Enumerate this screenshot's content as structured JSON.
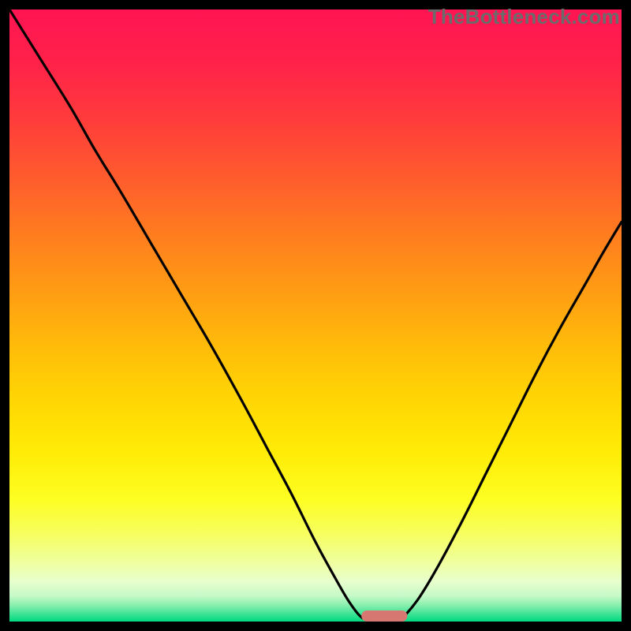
{
  "watermark": "TheBottleneck.com",
  "chart_data": {
    "type": "line",
    "title": "",
    "xlabel": "",
    "ylabel": "",
    "xlim": [
      0,
      100
    ],
    "ylim": [
      0,
      100
    ],
    "grid": false,
    "legend": false,
    "background_gradient": {
      "stops": [
        {
          "offset": 0.0,
          "color": "#ff1453"
        },
        {
          "offset": 0.09,
          "color": "#ff2249"
        },
        {
          "offset": 0.18,
          "color": "#ff3c3b"
        },
        {
          "offset": 0.27,
          "color": "#ff5a2e"
        },
        {
          "offset": 0.36,
          "color": "#ff7a20"
        },
        {
          "offset": 0.45,
          "color": "#ff9914"
        },
        {
          "offset": 0.54,
          "color": "#ffb80a"
        },
        {
          "offset": 0.63,
          "color": "#ffd404"
        },
        {
          "offset": 0.72,
          "color": "#ffeb05"
        },
        {
          "offset": 0.8,
          "color": "#fdfe22"
        },
        {
          "offset": 0.86,
          "color": "#f6ff63"
        },
        {
          "offset": 0.905,
          "color": "#efffa2"
        },
        {
          "offset": 0.935,
          "color": "#e7ffcd"
        },
        {
          "offset": 0.958,
          "color": "#c6f9c8"
        },
        {
          "offset": 0.972,
          "color": "#8ff0b0"
        },
        {
          "offset": 0.983,
          "color": "#55e79e"
        },
        {
          "offset": 0.993,
          "color": "#22df8c"
        },
        {
          "offset": 1.0,
          "color": "#00db82"
        }
      ]
    },
    "series": [
      {
        "name": "bottleneck-left",
        "type": "curve",
        "description": "Left descending curve approaching the optimum from x=0",
        "points": [
          {
            "x": 0.0,
            "y": 100.0
          },
          {
            "x": 5.0,
            "y": 92.0
          },
          {
            "x": 10.0,
            "y": 84.0
          },
          {
            "x": 14.0,
            "y": 77.0
          },
          {
            "x": 18.0,
            "y": 70.5
          },
          {
            "x": 23.0,
            "y": 62.0
          },
          {
            "x": 28.0,
            "y": 53.5
          },
          {
            "x": 33.0,
            "y": 45.0
          },
          {
            "x": 38.0,
            "y": 36.0
          },
          {
            "x": 42.0,
            "y": 28.5
          },
          {
            "x": 46.0,
            "y": 21.0
          },
          {
            "x": 50.0,
            "y": 13.0
          },
          {
            "x": 53.0,
            "y": 7.5
          },
          {
            "x": 55.0,
            "y": 4.0
          },
          {
            "x": 56.5,
            "y": 1.8
          },
          {
            "x": 57.5,
            "y": 0.7
          },
          {
            "x": 58.5,
            "y": 0.1
          }
        ]
      },
      {
        "name": "bottleneck-right",
        "type": "curve",
        "description": "Right ascending curve leaving the optimum toward x=100",
        "points": [
          {
            "x": 63.5,
            "y": 0.1
          },
          {
            "x": 64.8,
            "y": 1.2
          },
          {
            "x": 67.0,
            "y": 4.0
          },
          {
            "x": 70.0,
            "y": 9.0
          },
          {
            "x": 74.0,
            "y": 16.5
          },
          {
            "x": 78.0,
            "y": 24.5
          },
          {
            "x": 82.0,
            "y": 32.5
          },
          {
            "x": 86.0,
            "y": 40.5
          },
          {
            "x": 90.0,
            "y": 48.0
          },
          {
            "x": 94.0,
            "y": 55.0
          },
          {
            "x": 97.0,
            "y": 60.3
          },
          {
            "x": 100.0,
            "y": 65.3
          }
        ]
      }
    ],
    "optimum_marker": {
      "description": "Pinkish rounded bar on x-axis marking optimal range",
      "x_start": 57.5,
      "x_end": 65.0,
      "y": 0.0,
      "color": "#d77772"
    }
  }
}
